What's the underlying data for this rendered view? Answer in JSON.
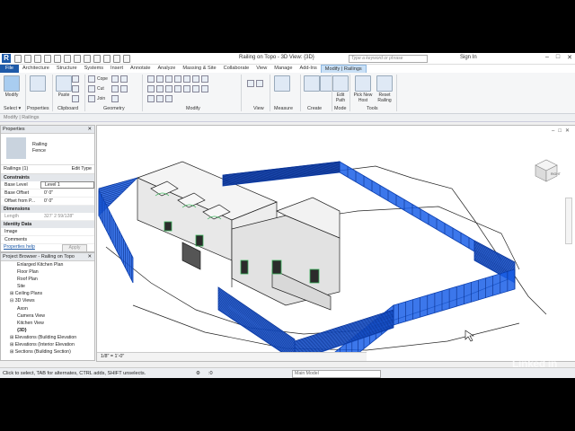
{
  "titlebar": {
    "logo": "R",
    "title": "Railing on Topo - 3D View: {3D}",
    "search_placeholder": "Type a keyword or phrase",
    "signin": "Sign In",
    "win_buttons": [
      "–",
      "□",
      "✕"
    ]
  },
  "tabs": [
    "File",
    "Architecture",
    "Structure",
    "Systems",
    "Insert",
    "Annotate",
    "Analyze",
    "Massing & Site",
    "Collaborate",
    "View",
    "Manage",
    "Add-Ins",
    "Modify | Railings"
  ],
  "ribbon": {
    "modify": "Modify",
    "properties": "Properties",
    "paste": "Paste",
    "cope": "Cope",
    "cut": "Cut",
    "join": "Join",
    "select": "Select",
    "clipboard": "Clipboard",
    "geometry": "Geometry",
    "modify_panel": "Modify",
    "view": "View",
    "measure": "Measure",
    "create": "Create",
    "edit_path": "Edit Path",
    "pick_new_host": "Pick New Host",
    "reset_railing": "Reset Railing",
    "mode": "Mode",
    "tools": "Tools"
  },
  "context_bar": "Modify | Railings",
  "properties": {
    "header": "Properties",
    "type_name": "Railing",
    "type_sub": "Fence",
    "filter": "Railings (1)",
    "edit_type": "Edit Type",
    "groups": {
      "constraints": "Constraints",
      "dimensions": "Dimensions",
      "identity": "Identity Data"
    },
    "rows": [
      {
        "key": "Base Level",
        "value": "Level 1"
      },
      {
        "key": "Base Offset",
        "value": "0' 0\""
      },
      {
        "key": "Offset from P...",
        "value": "0' 0\""
      }
    ],
    "length": {
      "key": "Length",
      "value": "327' 2 59/128\""
    },
    "identity_rows": [
      {
        "key": "Image",
        "value": ""
      },
      {
        "key": "Comments",
        "value": ""
      }
    ],
    "help": "Properties help",
    "apply": "Apply"
  },
  "browser": {
    "header": "Project Browser - Railing on Topo",
    "items": [
      {
        "label": "Enlarged Kitchen Plan",
        "indent": 4
      },
      {
        "label": "Floor Plan",
        "indent": 4
      },
      {
        "label": "Roof Plan",
        "indent": 4
      },
      {
        "label": "Site",
        "indent": 4
      },
      {
        "label": "Ceiling Plans",
        "indent": 2,
        "toggle": "⊞"
      },
      {
        "label": "3D Views",
        "indent": 2,
        "toggle": "⊟"
      },
      {
        "label": "Axon",
        "indent": 4
      },
      {
        "label": "Camera View",
        "indent": 4
      },
      {
        "label": "Kitchen View",
        "indent": 4
      },
      {
        "label": "{3D}",
        "indent": 4,
        "bold": true
      },
      {
        "label": "Elevations (Building Elevation",
        "indent": 2,
        "toggle": "⊞"
      },
      {
        "label": "Elevations (Interior Elevation",
        "indent": 2,
        "toggle": "⊞"
      },
      {
        "label": "Sections (Building Section)",
        "indent": 2,
        "toggle": "⊞"
      }
    ]
  },
  "view": {
    "scale": "1/8\" = 1'-0\"",
    "viewcube_label": "RIGHT"
  },
  "status": {
    "message": "Click to select, TAB for alternates, CTRL adds, SHIFT unselects.",
    "model": "Main Model",
    "filter_count": ":0"
  },
  "watermark": "Linked in",
  "colors": {
    "railing": "#1a5fe8",
    "file_tab": "#1e5aa8",
    "active_tab": "#c9e0f6"
  }
}
